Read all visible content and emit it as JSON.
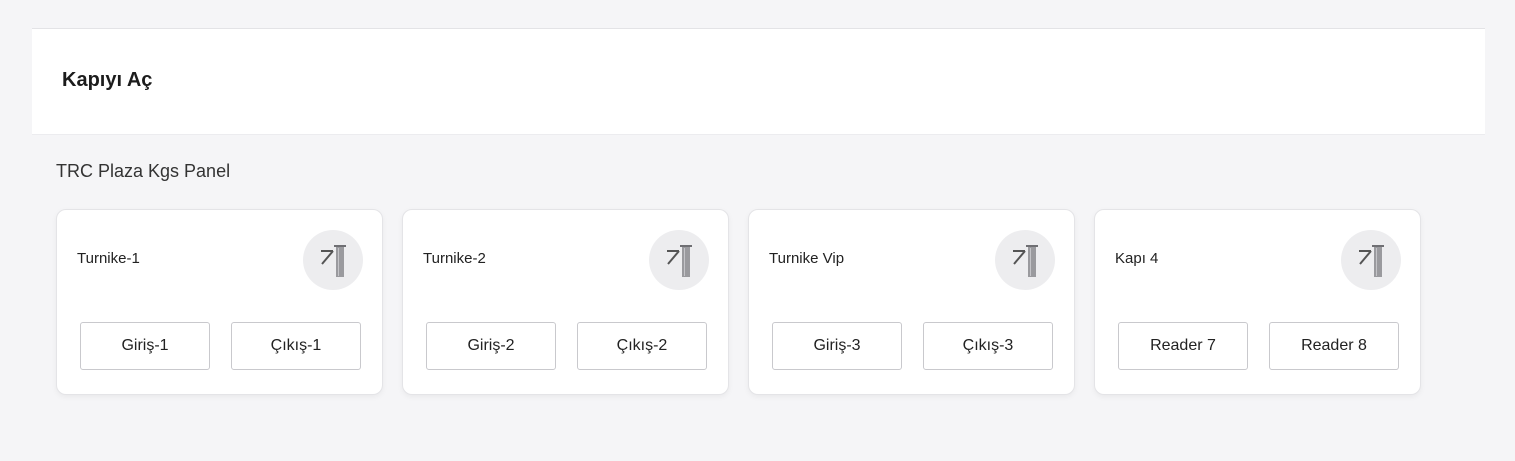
{
  "header": {
    "title": "Kapıyı Aç"
  },
  "panel": {
    "name": "TRC Plaza Kgs Panel"
  },
  "doors": [
    {
      "name": "Turnike-1",
      "icon": "turnstile-icon",
      "buttons": [
        "Giriş-1",
        "Çıkış-1"
      ]
    },
    {
      "name": "Turnike-2",
      "icon": "turnstile-icon",
      "buttons": [
        "Giriş-2",
        "Çıkış-2"
      ]
    },
    {
      "name": "Turnike Vip",
      "icon": "turnstile-icon",
      "buttons": [
        "Giriş-3",
        "Çıkış-3"
      ]
    },
    {
      "name": "Kapı 4",
      "icon": "turnstile-icon",
      "buttons": [
        "Reader 7",
        "Reader 8"
      ]
    }
  ]
}
